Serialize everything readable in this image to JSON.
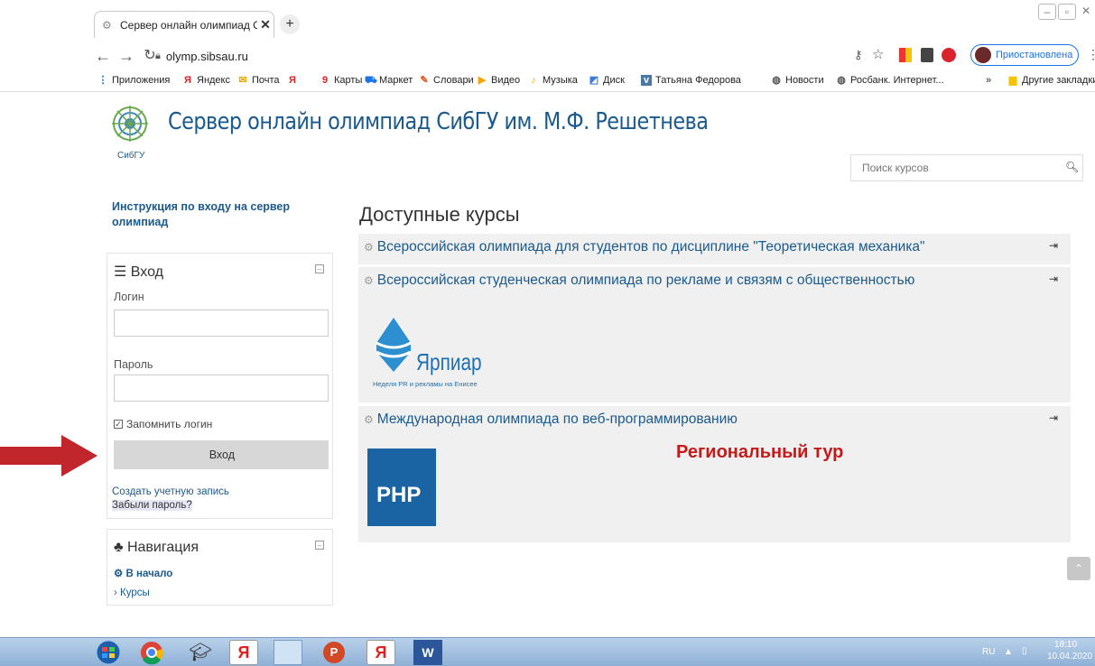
{
  "browser": {
    "tab_title": "Сервер онлайн олимпиад СибГ",
    "url": "olymp.sibsau.ru",
    "profile_label": "Приостановлена",
    "bookmarks": [
      {
        "label": "Приложения",
        "icon": "apps-grid-icon"
      },
      {
        "label": "Яндекс",
        "icon": "yandex-icon"
      },
      {
        "label": "Почта",
        "icon": "mail-icon"
      },
      {
        "label": "Я",
        "icon": "yandex-icon"
      },
      {
        "label": "Карты",
        "icon": "maps-pin-icon"
      },
      {
        "label": "Маркет",
        "icon": "market-icon"
      },
      {
        "label": "Словари",
        "icon": "dictionary-icon"
      },
      {
        "label": "Видео",
        "icon": "video-icon"
      },
      {
        "label": "Музыка",
        "icon": "music-icon"
      },
      {
        "label": "Диск",
        "icon": "disk-icon"
      },
      {
        "label": "Татьяна Федорова",
        "icon": "vk-icon"
      },
      {
        "label": "Новости",
        "icon": "globe-icon"
      },
      {
        "label": "Росбанк. Интернет...",
        "icon": "globe-icon"
      }
    ],
    "bookmarks_overflow": "»",
    "other_bookmarks": "Другие закладки"
  },
  "page": {
    "logo_text": "СибГУ",
    "site_title": "Сервер онлайн олимпиад СибГУ им. М.Ф. Решетнева",
    "search_placeholder": "Поиск курсов",
    "instruction_link": "Инструкция по входу на сервер олимпиад",
    "login_block": {
      "title": "Вход",
      "login_label": "Логин",
      "login_value": "",
      "password_label": "Пароль",
      "password_value": "",
      "remember_label": "Запомнить логин",
      "remember_checked": true,
      "submit_label": "Вход",
      "create_account": "Создать учетную запись",
      "forgot_password": "Забыли пароль?"
    },
    "nav_block": {
      "title": "Навигация",
      "home": "В начало",
      "courses": "Курсы"
    },
    "courses_heading": "Доступные курсы",
    "courses": [
      {
        "title": "Всероссийская олимпиада для студентов по дисциплине \"Теоретическая механика\""
      },
      {
        "title": "Всероссийская студенческая олимпиада по рекламе и связям с общественностью",
        "image_caption": "Ярпиар",
        "image_subcaption": "Неделя PR и рекламы на Енисее"
      },
      {
        "title": "Международная олимпиада по веб-программированию",
        "badge": "PHP",
        "summary": "Региональный тур"
      }
    ]
  },
  "taskbar": {
    "lang": "RU",
    "time": "18:10",
    "date": "10.04.2020"
  },
  "colors": {
    "link": "#1a5a8e",
    "accent_red": "#c41a1a",
    "php_blue": "#1b64a4",
    "course_bg": "#f0f0f0"
  }
}
